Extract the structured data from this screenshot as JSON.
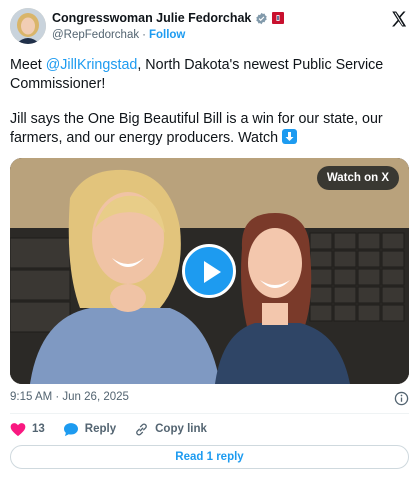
{
  "author": {
    "display_name": "Congresswoman Julie Fedorchak",
    "handle": "@RepFedorchak",
    "follow_label": "Follow"
  },
  "tweet": {
    "text_p1_before": "Meet ",
    "mention": "@JillKringstad",
    "text_p1_after": ", North Dakota's newest Public Service Commissioner!",
    "text_p2": "Jill says the One Big Beautiful Bill is a win for our state, our farmers, and our energy producers. Watch "
  },
  "media": {
    "watch_label": "Watch on X"
  },
  "timestamp": "9:15 AM · Jun 26, 2025",
  "actions": {
    "like_count": "13",
    "reply_label": "Reply",
    "copy_link_label": "Copy link"
  },
  "read_replies_label": "Read 1 reply",
  "colors": {
    "accent": "#1d9bf0",
    "like": "#f91880",
    "text_secondary": "#536471"
  },
  "icons": [
    "verified-badge-icon",
    "flag-icon",
    "x-logo-icon",
    "down-arrow-emoji-icon",
    "play-icon",
    "info-icon",
    "heart-icon",
    "reply-bubble-icon",
    "copy-link-icon"
  ]
}
